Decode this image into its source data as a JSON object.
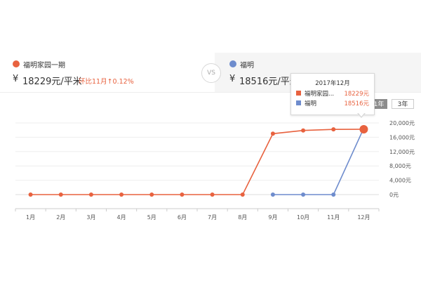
{
  "compare": {
    "left": {
      "name": "福明家园一期",
      "currency": "¥",
      "price": "18229元/平米",
      "change": "环比11月↑0.12%",
      "color": "#e8623f"
    },
    "vs_label": "VS",
    "right": {
      "name": "福明",
      "currency": "¥",
      "price": "18516元/平米",
      "color": "#6e8ccd"
    }
  },
  "range_tabs": [
    {
      "label": "1年",
      "active": true
    },
    {
      "label": "3年",
      "active": false
    }
  ],
  "tooltip": {
    "title": "2017年12月",
    "rows": [
      {
        "name": "福明家园...",
        "value": "18229元",
        "color": "#e8623f"
      },
      {
        "name": "福明",
        "value": "18516元",
        "color": "#6e8ccd"
      }
    ]
  },
  "chart_data": {
    "type": "line",
    "categories": [
      "1月",
      "2月",
      "3月",
      "4月",
      "5月",
      "6月",
      "7月",
      "8月",
      "9月",
      "10月",
      "11月",
      "12月"
    ],
    "series": [
      {
        "name": "福明家园一期",
        "color": "#e8623f",
        "values": [
          0,
          0,
          0,
          0,
          0,
          0,
          0,
          0,
          17000,
          17900,
          18200,
          18229
        ]
      },
      {
        "name": "福明",
        "color": "#6e8ccd",
        "values": [
          null,
          null,
          null,
          null,
          null,
          null,
          null,
          null,
          0,
          0,
          0,
          18516
        ]
      }
    ],
    "y_ticks": [
      "0元",
      "4,000元",
      "8,000元",
      "12,000元",
      "16,000元",
      "20,000元"
    ],
    "y_tick_values": [
      0,
      4000,
      8000,
      12000,
      16000,
      20000
    ],
    "ylim": [
      0,
      20000
    ],
    "grid": true
  }
}
